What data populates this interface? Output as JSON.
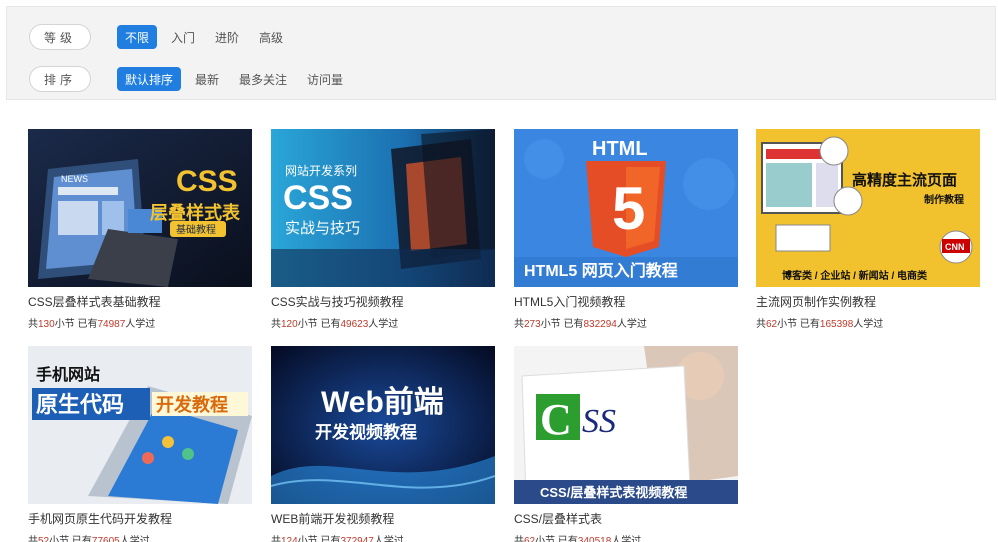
{
  "filters": {
    "level": {
      "label": "等级",
      "options": [
        "不限",
        "入门",
        "进阶",
        "高级"
      ],
      "active": 0
    },
    "sort": {
      "label": "排序",
      "options": [
        "默认排序",
        "最新",
        "最多关注",
        "访问量"
      ],
      "active": 0
    }
  },
  "meta_text": {
    "prefix": "共",
    "unit_sections": "小节 已有",
    "suffix": "人学过"
  },
  "courses": [
    {
      "title": "CSS层叠样式表基础教程",
      "sections": "130",
      "learners": "74987",
      "thumb": {
        "headline": "CSS",
        "subtitle": "层叠样式表",
        "tag": "基础教程",
        "small": "NEWS"
      }
    },
    {
      "title": "CSS实战与技巧视频教程",
      "sections": "120",
      "learners": "49623",
      "thumb": {
        "series": "网站开发系列",
        "headline": "CSS",
        "subtitle": "实战与技巧"
      }
    },
    {
      "title": "HTML5入门视频教程",
      "sections": "273",
      "learners": "832294",
      "thumb": {
        "top": "HTML",
        "digit": "5",
        "bottom": "HTML5 网页入门教程"
      }
    },
    {
      "title": "主流网页制作实例教程",
      "sections": "62",
      "learners": "165398",
      "thumb": {
        "headline": "高精度主流页面",
        "tag": "制作教程",
        "categories": "博客类 / 企业站 / 新闻站 / 电商类",
        "badge": "CNN"
      }
    },
    {
      "title": "手机网页原生代码开发教程",
      "sections": "52",
      "learners": "77605",
      "thumb": {
        "line1": "手机网站",
        "line2": "原生代码",
        "line3": "开发教程"
      }
    },
    {
      "title": "WEB前端开发视频教程",
      "sections": "124",
      "learners": "372947",
      "thumb": {
        "headline": "Web前端",
        "subtitle": "开发视频教程"
      }
    },
    {
      "title": "CSS/层叠样式表",
      "sections": "62",
      "learners": "340518",
      "thumb": {
        "logo_c": "C",
        "logo_ss": "SS",
        "caption": "CSS/层叠样式表视频教程"
      }
    }
  ]
}
